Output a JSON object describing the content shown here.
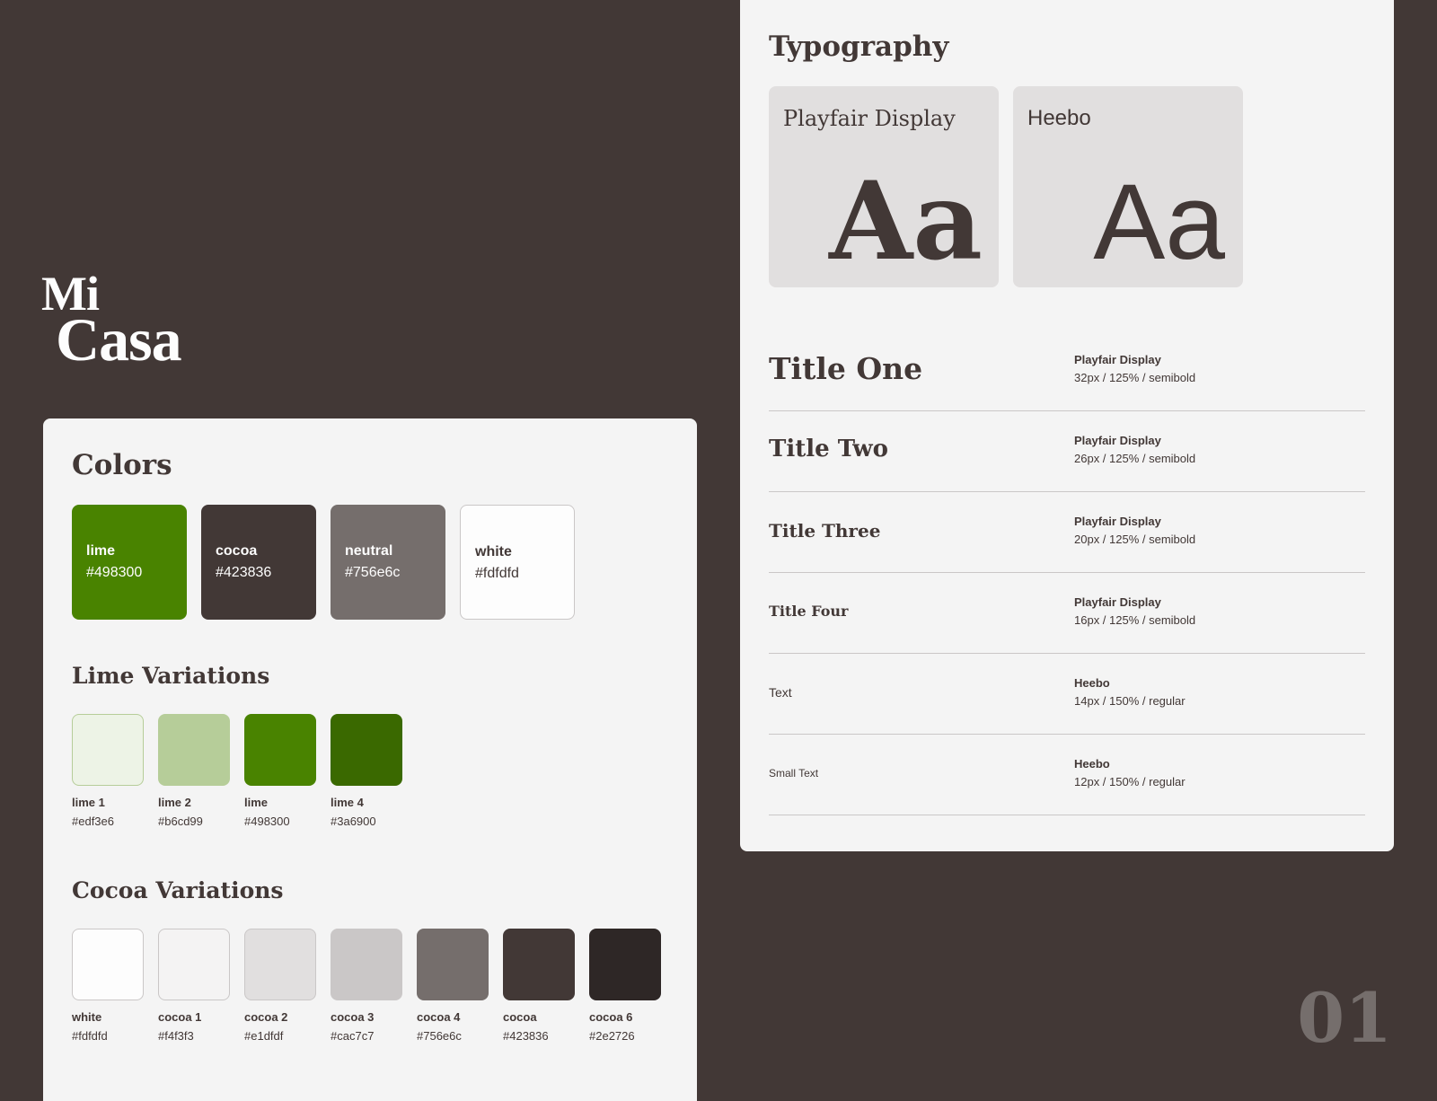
{
  "logo": {
    "line1": "Mi",
    "line2": "Casa"
  },
  "colors": {
    "title": "Colors",
    "primary": [
      {
        "name": "lime",
        "hex": "#498300",
        "text_color": "#fdfdfd"
      },
      {
        "name": "cocoa",
        "hex": "#423836",
        "text_color": "#fdfdfd"
      },
      {
        "name": "neutral",
        "hex": "#756e6c",
        "text_color": "#fdfdfd"
      },
      {
        "name": "white",
        "hex": "#fdfdfd",
        "text_color": "#423836"
      }
    ],
    "lime_title": "Lime Variations",
    "lime_variations": [
      {
        "name": "lime 1",
        "hex": "#edf3e6"
      },
      {
        "name": "lime 2",
        "hex": "#b6cd99"
      },
      {
        "name": "lime",
        "hex": "#498300"
      },
      {
        "name": "lime 4",
        "hex": "#3a6900"
      }
    ],
    "cocoa_title": "Cocoa Variations",
    "cocoa_variations": [
      {
        "name": "white",
        "hex": "#fdfdfd"
      },
      {
        "name": "cocoa 1",
        "hex": "#f4f3f3"
      },
      {
        "name": "cocoa 2",
        "hex": "#e1dfdf"
      },
      {
        "name": "cocoa 3",
        "hex": "#cac7c7"
      },
      {
        "name": "cocoa 4",
        "hex": "#756e6c"
      },
      {
        "name": "cocoa",
        "hex": "#423836"
      },
      {
        "name": "cocoa 6",
        "hex": "#2e2726"
      }
    ]
  },
  "typography": {
    "title": "Typography",
    "fonts": [
      {
        "name": "Playfair Display",
        "sample": "Aa"
      },
      {
        "name": "Heebo",
        "sample": "Aa"
      }
    ],
    "scale": [
      {
        "label": "Title One",
        "font": "Playfair Display",
        "spec": "32px / 125% / semibold"
      },
      {
        "label": "Title Two",
        "font": "Playfair Display",
        "spec": "26px / 125% / semibold"
      },
      {
        "label": "Title Three",
        "font": "Playfair Display",
        "spec": "20px / 125% / semibold"
      },
      {
        "label": "Title Four",
        "font": "Playfair Display",
        "spec": "16px / 125% / semibold"
      },
      {
        "label": "Text",
        "font": "Heebo",
        "spec": "14px / 150% / regular"
      },
      {
        "label": "Small Text",
        "font": "Heebo",
        "spec": "12px / 150% / regular"
      }
    ]
  },
  "page_number": "01"
}
